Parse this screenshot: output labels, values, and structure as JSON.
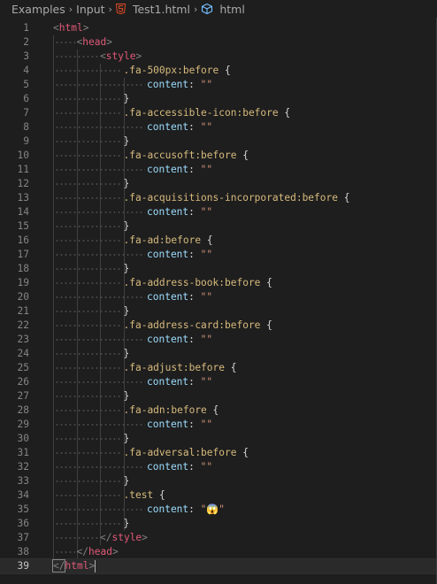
{
  "breadcrumb": {
    "items": [
      "Examples",
      "Input",
      "Test1.html",
      "html"
    ],
    "separator": "›"
  },
  "editor": {
    "current_line": 39,
    "lines": [
      {
        "n": "1",
        "indent": 0,
        "tokens": [
          [
            "punc",
            "<"
          ],
          [
            "tag",
            "html"
          ],
          [
            "punc",
            ">"
          ]
        ]
      },
      {
        "n": "2",
        "indent": 1,
        "tokens": [
          [
            "punc",
            "<"
          ],
          [
            "tag",
            "head"
          ],
          [
            "punc",
            ">"
          ]
        ]
      },
      {
        "n": "3",
        "indent": 2,
        "tokens": [
          [
            "punc",
            "<"
          ],
          [
            "tag",
            "style"
          ],
          [
            "punc",
            ">"
          ]
        ]
      },
      {
        "n": "4",
        "indent": 3,
        "tokens": [
          [
            "sel",
            ".fa-500px:before"
          ],
          [
            "plain",
            " "
          ],
          [
            "brace",
            "{"
          ]
        ]
      },
      {
        "n": "5",
        "indent": 4,
        "tokens": [
          [
            "prop",
            "content"
          ],
          [
            "plain",
            ": "
          ],
          [
            "str",
            "\"\""
          ]
        ]
      },
      {
        "n": "6",
        "indent": 3,
        "tokens": [
          [
            "brace",
            "}"
          ]
        ]
      },
      {
        "n": "7",
        "indent": 3,
        "tokens": [
          [
            "sel",
            ".fa-accessible-icon:before"
          ],
          [
            "plain",
            " "
          ],
          [
            "brace",
            "{"
          ]
        ]
      },
      {
        "n": "8",
        "indent": 4,
        "tokens": [
          [
            "prop",
            "content"
          ],
          [
            "plain",
            ": "
          ],
          [
            "str",
            "\"\""
          ]
        ]
      },
      {
        "n": "9",
        "indent": 3,
        "tokens": [
          [
            "brace",
            "}"
          ]
        ]
      },
      {
        "n": "10",
        "indent": 3,
        "tokens": [
          [
            "sel",
            ".fa-accusoft:before"
          ],
          [
            "plain",
            " "
          ],
          [
            "brace",
            "{"
          ]
        ]
      },
      {
        "n": "11",
        "indent": 4,
        "tokens": [
          [
            "prop",
            "content"
          ],
          [
            "plain",
            ": "
          ],
          [
            "str",
            "\"\""
          ]
        ]
      },
      {
        "n": "12",
        "indent": 3,
        "tokens": [
          [
            "brace",
            "}"
          ]
        ]
      },
      {
        "n": "13",
        "indent": 3,
        "tokens": [
          [
            "sel",
            ".fa-acquisitions-incorporated:before"
          ],
          [
            "plain",
            " "
          ],
          [
            "brace",
            "{"
          ]
        ]
      },
      {
        "n": "14",
        "indent": 4,
        "tokens": [
          [
            "prop",
            "content"
          ],
          [
            "plain",
            ": "
          ],
          [
            "str",
            "\"\""
          ]
        ]
      },
      {
        "n": "15",
        "indent": 3,
        "tokens": [
          [
            "brace",
            "}"
          ]
        ]
      },
      {
        "n": "16",
        "indent": 3,
        "tokens": [
          [
            "sel",
            ".fa-ad:before"
          ],
          [
            "plain",
            " "
          ],
          [
            "brace",
            "{"
          ]
        ]
      },
      {
        "n": "17",
        "indent": 4,
        "tokens": [
          [
            "prop",
            "content"
          ],
          [
            "plain",
            ": "
          ],
          [
            "str",
            "\"\""
          ]
        ]
      },
      {
        "n": "18",
        "indent": 3,
        "tokens": [
          [
            "brace",
            "}"
          ]
        ]
      },
      {
        "n": "19",
        "indent": 3,
        "tokens": [
          [
            "sel",
            ".fa-address-book:before"
          ],
          [
            "plain",
            " "
          ],
          [
            "brace",
            "{"
          ]
        ]
      },
      {
        "n": "20",
        "indent": 4,
        "tokens": [
          [
            "prop",
            "content"
          ],
          [
            "plain",
            ": "
          ],
          [
            "str",
            "\"\""
          ]
        ]
      },
      {
        "n": "21",
        "indent": 3,
        "tokens": [
          [
            "brace",
            "}"
          ]
        ]
      },
      {
        "n": "22",
        "indent": 3,
        "tokens": [
          [
            "sel",
            ".fa-address-card:before"
          ],
          [
            "plain",
            " "
          ],
          [
            "brace",
            "{"
          ]
        ]
      },
      {
        "n": "23",
        "indent": 4,
        "tokens": [
          [
            "prop",
            "content"
          ],
          [
            "plain",
            ": "
          ],
          [
            "str",
            "\"\""
          ]
        ]
      },
      {
        "n": "24",
        "indent": 3,
        "tokens": [
          [
            "brace",
            "}"
          ]
        ]
      },
      {
        "n": "25",
        "indent": 3,
        "tokens": [
          [
            "sel",
            ".fa-adjust:before"
          ],
          [
            "plain",
            " "
          ],
          [
            "brace",
            "{"
          ]
        ]
      },
      {
        "n": "26",
        "indent": 4,
        "tokens": [
          [
            "prop",
            "content"
          ],
          [
            "plain",
            ": "
          ],
          [
            "str",
            "\"\""
          ]
        ]
      },
      {
        "n": "27",
        "indent": 3,
        "tokens": [
          [
            "brace",
            "}"
          ]
        ]
      },
      {
        "n": "28",
        "indent": 3,
        "tokens": [
          [
            "sel",
            ".fa-adn:before"
          ],
          [
            "plain",
            " "
          ],
          [
            "brace",
            "{"
          ]
        ]
      },
      {
        "n": "29",
        "indent": 4,
        "tokens": [
          [
            "prop",
            "content"
          ],
          [
            "plain",
            ": "
          ],
          [
            "str",
            "\"\""
          ]
        ]
      },
      {
        "n": "30",
        "indent": 3,
        "tokens": [
          [
            "brace",
            "}"
          ]
        ]
      },
      {
        "n": "31",
        "indent": 3,
        "tokens": [
          [
            "sel",
            ".fa-adversal:before"
          ],
          [
            "plain",
            " "
          ],
          [
            "brace",
            "{"
          ]
        ]
      },
      {
        "n": "32",
        "indent": 4,
        "tokens": [
          [
            "prop",
            "content"
          ],
          [
            "plain",
            ": "
          ],
          [
            "str",
            "\"\""
          ]
        ]
      },
      {
        "n": "33",
        "indent": 3,
        "tokens": [
          [
            "brace",
            "}"
          ]
        ]
      },
      {
        "n": "34",
        "indent": 3,
        "tokens": [
          [
            "sel",
            ".test"
          ],
          [
            "plain",
            " "
          ],
          [
            "brace",
            "{"
          ]
        ]
      },
      {
        "n": "35",
        "indent": 4,
        "tokens": [
          [
            "prop",
            "content"
          ],
          [
            "plain",
            ": "
          ],
          [
            "str",
            "\"😱\""
          ]
        ]
      },
      {
        "n": "36",
        "indent": 3,
        "tokens": [
          [
            "brace",
            "}"
          ]
        ]
      },
      {
        "n": "37",
        "indent": 2,
        "tokens": [
          [
            "punc",
            "</"
          ],
          [
            "tag",
            "style"
          ],
          [
            "punc",
            ">"
          ]
        ]
      },
      {
        "n": "38",
        "indent": 1,
        "tokens": [
          [
            "punc",
            "</"
          ],
          [
            "tag",
            "head"
          ],
          [
            "punc",
            ">"
          ]
        ]
      },
      {
        "n": "39",
        "indent": 0,
        "tokens": [
          [
            "punc",
            "</"
          ],
          [
            "tag",
            "html"
          ],
          [
            "punc",
            ">"
          ]
        ]
      }
    ]
  },
  "colors": {
    "background": "#1e1e1e",
    "tag": "#e05a78",
    "selector": "#d7ba7d",
    "property": "#9cdcfe",
    "string": "#ce9178",
    "html5_icon": "#e44d26",
    "cube_icon": "#75beff"
  }
}
